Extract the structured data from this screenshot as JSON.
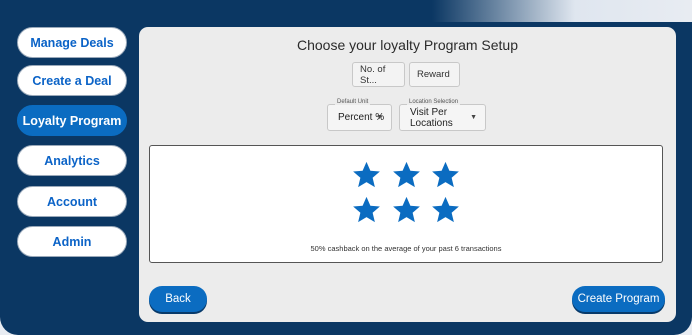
{
  "sidebar": {
    "items": [
      {
        "label": "Manage Deals"
      },
      {
        "label": "Create a Deal"
      },
      {
        "label": "Loyalty Program",
        "active": true
      },
      {
        "label": "Analytics"
      },
      {
        "label": "Account"
      },
      {
        "label": "Admin"
      }
    ]
  },
  "main": {
    "title": "Choose your loyalty Program Setup",
    "stamps_field": {
      "value": "No. of St..."
    },
    "reward_field": {
      "value": "Reward"
    },
    "default_unit": {
      "label": "Default Unit",
      "value": "Percent %"
    },
    "location_selection": {
      "label": "Location Selection",
      "value": "Visit Per Locations"
    },
    "preview": {
      "stars_shown": 6,
      "caption": "50% cashback on the average of your past 6 transactions"
    },
    "back_label": "Back",
    "create_label": "Create Program"
  },
  "colors": {
    "frame": "#0b3763",
    "accent": "#0b6cc1",
    "nav_text": "#0b63c7",
    "star": "#0b6cc1"
  },
  "icons": {
    "star": "star-icon",
    "caret": "caret-down-icon"
  }
}
